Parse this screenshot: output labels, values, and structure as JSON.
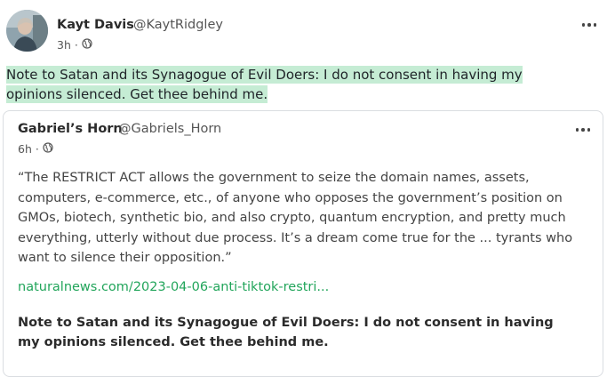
{
  "post": {
    "author_name": "Kayt Davis",
    "author_handle": "@KaytRidgley",
    "time": "3h",
    "separator": "·",
    "visibility_icon": "globe-icon",
    "more_icon": "ellipsis-icon",
    "text": "Note to Satan and its Synagogue of Evil Doers: I do not consent in having my opinions silenced. Get thee behind me."
  },
  "quoted": {
    "author_name": "Gabriel’s Horn",
    "author_handle": "@Gabriels_Horn",
    "time": "6h",
    "separator": "·",
    "visibility_icon": "globe-icon",
    "more_icon": "ellipsis-icon",
    "body": "“The RESTRICT ACT allows the government to seize the domain names, assets, computers, e-commerce, etc., of anyone who opposes the government’s position on GMOs, biotech, synthetic bio, and also crypto, quantum encryption, and pretty much everything, utterly without due process. It’s a dream come true for the ... tyrants who want to silence their opposition.”",
    "link_text": "naturalnews.com/2023-04-06-anti-tiktok-restri...",
    "note": "Note to Satan and its Synagogue of Evil Doers: I do not consent in having my opinions silenced. Get thee behind me."
  },
  "colors": {
    "highlight": "#c5ecd4",
    "link": "#22a55b",
    "border": "#dadde1"
  }
}
